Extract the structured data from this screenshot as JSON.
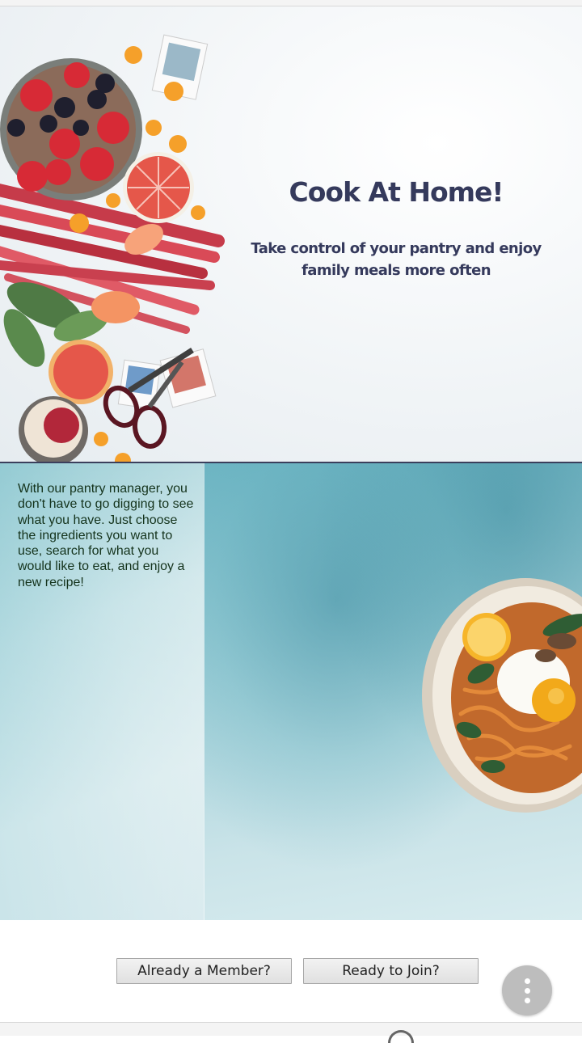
{
  "hero": {
    "title": "Cook At Home!",
    "subtitle": "Take control of your pantry and enjoy family meals more often"
  },
  "pantry": {
    "description": "With our pantry manager, you don't have to go digging to see what you have. Just choose the ingredients you want to use, search for what you would like to eat, and enjoy a new recipe!"
  },
  "footer": {
    "member_label": "Already a Member?",
    "join_label": "Ready to Join?",
    "fab_icon": "more-vertical-icon"
  },
  "colors": {
    "title": "#353a5c",
    "pantry_text": "#14331c",
    "fab": "#bdbdbd"
  }
}
